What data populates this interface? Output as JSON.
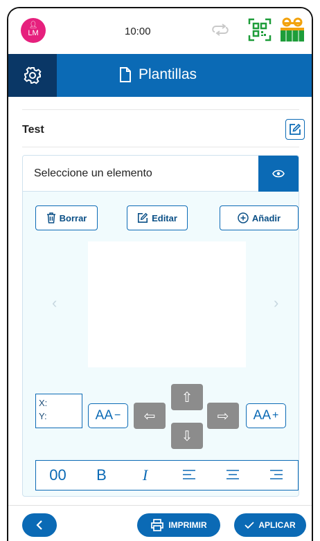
{
  "status_bar": {
    "avatar_initials": "LM",
    "time": "10:00"
  },
  "header": {
    "title": "Plantillas"
  },
  "template": {
    "name": "Test"
  },
  "element_panel": {
    "select_label": "Seleccione un elemento",
    "buttons": {
      "delete": "Borrar",
      "edit": "Editar",
      "add": "Añadir"
    },
    "coords": {
      "x_label": "X:",
      "y_label": "Y:"
    },
    "font_size": {
      "decrease_label": "AA",
      "decrease_symbol": "−",
      "increase_label": "AA",
      "increase_symbol": "+"
    },
    "format_bar": {
      "size_value": "00",
      "bold_label": "B",
      "italic_label": "I"
    }
  },
  "footer": {
    "print_label": "IMPRIMIR",
    "apply_label": "APLICAR"
  },
  "colors": {
    "primary": "#0b6ab5",
    "primary_dark": "#0a3766",
    "avatar": "#e6207d",
    "qr_green": "#1e9d3a",
    "battery_orange": "#f2a20c",
    "arrow_gray": "#8c8c8c",
    "panel_bg": "#f1fbfd"
  },
  "icons": {
    "settings": "gear-icon",
    "document": "document-icon",
    "edit": "edit-icon",
    "visibility": "eye-icon",
    "delete": "trash-icon",
    "add": "plus-circle-icon",
    "print": "printer-icon",
    "apply": "check-icon",
    "back": "chevron-left-icon"
  }
}
